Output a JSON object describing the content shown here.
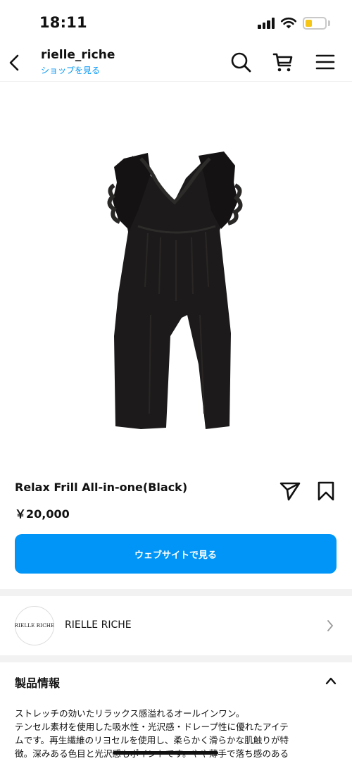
{
  "status_bar": {
    "time": "18:11"
  },
  "header": {
    "title": "rielle_riche",
    "subtitle": "ショップを見る",
    "icons": [
      "back-icon",
      "search-icon",
      "cart-icon",
      "menu-icon"
    ]
  },
  "product": {
    "name": "Relax Frill All-in-one(Black)",
    "price": "￥20,000",
    "cta_label": "ウェブサイトで見る",
    "image_alt_icon": "jumpsuit-image"
  },
  "shop": {
    "logo_text": "RIELLE RICHE",
    "name": "RIELLE RICHE"
  },
  "details": {
    "title": "製品情報",
    "lines": [
      "ストレッチの効いたリラックス感溢れるオールインワン。",
      "テンセル素材を使用した吸水性・光沢感・ドレープ性に優れたアイテ",
      "ムです。再生繊維のリヨセルを使用し、柔らかく滑らかな肌触りが特",
      "徴。深みある色目と光沢感もポイントです。やや薄手で落ち感のある"
    ]
  },
  "colors": {
    "accent": "#0095f6",
    "battery": "#f5c518",
    "divider": "#f2f2f2"
  }
}
